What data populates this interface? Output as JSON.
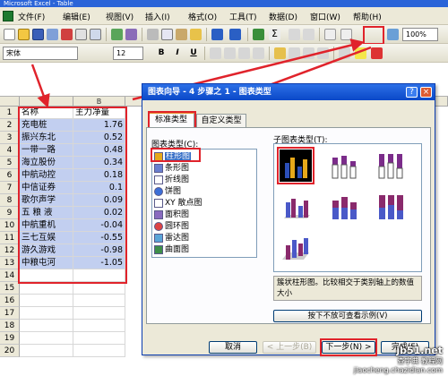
{
  "window": {
    "title": "Microsoft Excel - Table"
  },
  "menu": [
    "文件(F)",
    "编辑(E)",
    "视图(V)",
    "插入(I)",
    "格式(O)",
    "工具(T)",
    "数据(D)",
    "窗口(W)",
    "帮助(H)"
  ],
  "toolbar": {
    "zoom": "100%",
    "font": "宋体",
    "size": "12",
    "bold": "B",
    "italic": "I",
    "underline": "U"
  },
  "sheet": {
    "columns": [
      "A",
      "B"
    ],
    "rows": [
      {
        "n": "1",
        "a": "名称",
        "b": "主力净量"
      },
      {
        "n": "2",
        "a": "充电桩",
        "b": "1.76"
      },
      {
        "n": "3",
        "a": "振兴东北",
        "b": "0.52"
      },
      {
        "n": "4",
        "a": "一带一路",
        "b": "0.48"
      },
      {
        "n": "5",
        "a": "海立股份",
        "b": "0.34"
      },
      {
        "n": "6",
        "a": "中航动控",
        "b": "0.18"
      },
      {
        "n": "7",
        "a": "中信证券",
        "b": "0.1"
      },
      {
        "n": "8",
        "a": "歌尔声学",
        "b": "0.09"
      },
      {
        "n": "9",
        "a": "五 粮 液",
        "b": "0.02"
      },
      {
        "n": "10",
        "a": "中航重机",
        "b": "-0.04"
      },
      {
        "n": "11",
        "a": "三七互娱",
        "b": "-0.55"
      },
      {
        "n": "12",
        "a": "游久游戏",
        "b": "-0.98"
      },
      {
        "n": "13",
        "a": "中粮屯河",
        "b": "-1.05"
      },
      {
        "n": "14",
        "a": "",
        "b": ""
      },
      {
        "n": "15",
        "a": "",
        "b": ""
      },
      {
        "n": "16",
        "a": "",
        "b": ""
      },
      {
        "n": "17",
        "a": "",
        "b": ""
      },
      {
        "n": "18",
        "a": "",
        "b": ""
      },
      {
        "n": "19",
        "a": "",
        "b": ""
      },
      {
        "n": "20",
        "a": "",
        "b": ""
      }
    ]
  },
  "dialog": {
    "title": "图表向导 - 4 步骤之 1 - 图表类型",
    "help": "?",
    "close": "×",
    "tabs": [
      "标准类型",
      "自定义类型"
    ],
    "chart_type_label": "图表类型(C):",
    "subtype_label": "子图表类型(T):",
    "chart_types": [
      "柱形图",
      "条形图",
      "折线图",
      "饼图",
      "XY 散点图",
      "面积图",
      "圆环图",
      "雷达图",
      "曲面图"
    ],
    "description": "簇状柱形图。比较相交于类别轴上的数值大小",
    "preview_button": "按下不放可查看示例(V)",
    "buttons": {
      "cancel": "取消",
      "back": "< 上一步(B)",
      "next": "下一步(N) >",
      "finish": "完成(F)"
    }
  },
  "watermark": {
    "site": "jb51.net",
    "name": "查字典 教程网",
    "url": "jiaocheng.chazidian.com"
  },
  "colors": {
    "highlight_red": "#e0232b",
    "selection_blue": "#316ac5",
    "cell_selection": "#c2cff0"
  }
}
